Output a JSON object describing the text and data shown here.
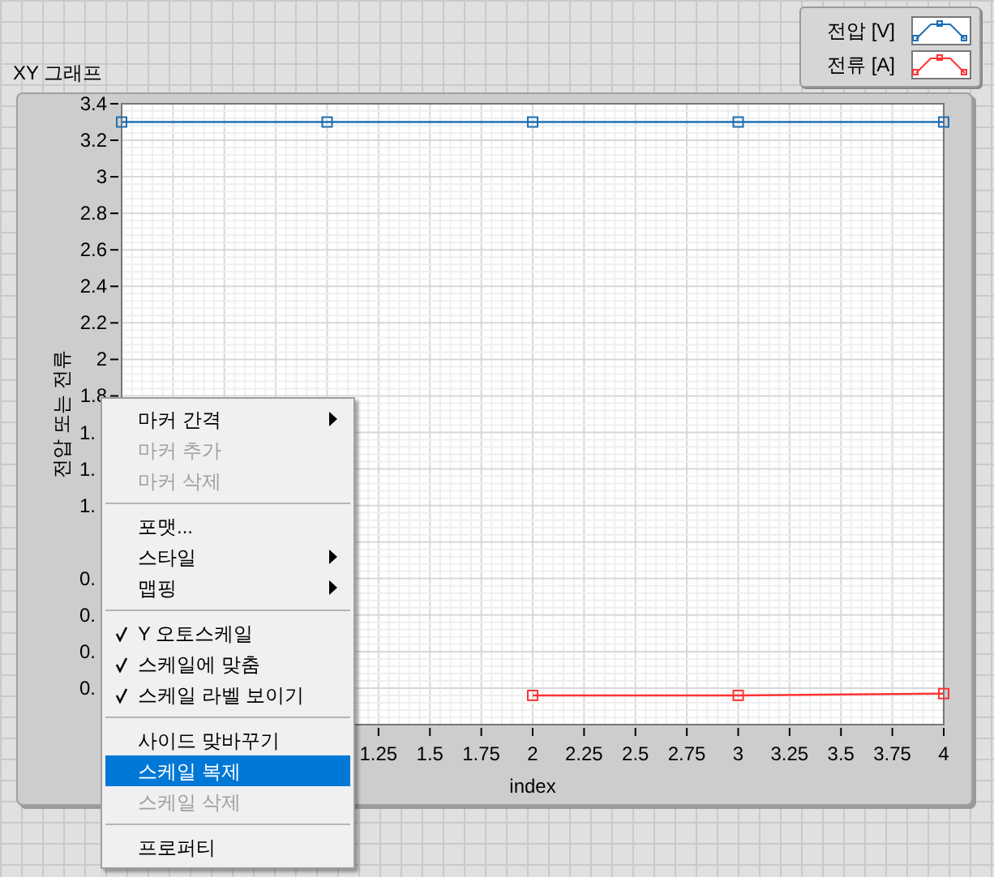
{
  "graph": {
    "title": "XY 그래프",
    "covered_y_labels": [
      "1.",
      "1.",
      "1.",
      "0.",
      "0.",
      "0.",
      "0."
    ],
    "chart_data": {
      "type": "line",
      "grid": true,
      "xlabel": "index",
      "ylabel": "전압 또는 전류",
      "xlim": [
        0,
        4
      ],
      "ylim": [
        0,
        3.4
      ],
      "xticks": [
        1.25,
        1.5,
        1.75,
        2,
        2.25,
        2.5,
        2.75,
        3,
        3.25,
        3.5,
        3.75,
        4
      ],
      "yticks": [
        1.8,
        2,
        2.2,
        2.4,
        2.6,
        2.8,
        3,
        3.2,
        3.4
      ],
      "x": [
        0,
        1,
        2,
        3,
        4
      ],
      "series": [
        {
          "name": "전압 [V]",
          "color": "#1f6fb4",
          "marker": "square",
          "values": [
            3.3,
            3.3,
            3.3,
            3.3,
            3.3
          ]
        },
        {
          "name": "전류 [A]",
          "color": "#ff3333",
          "marker": "square",
          "values": [
            null,
            null,
            0.16,
            0.16,
            0.17
          ]
        }
      ]
    }
  },
  "context_menu": [
    {
      "kind": "item",
      "label": "마커 간격",
      "submenu": true,
      "disabled": false,
      "checked": false,
      "selected": false
    },
    {
      "kind": "item",
      "label": "마커 추가",
      "submenu": false,
      "disabled": true,
      "checked": false,
      "selected": false
    },
    {
      "kind": "item",
      "label": "마커 삭제",
      "submenu": false,
      "disabled": true,
      "checked": false,
      "selected": false
    },
    {
      "kind": "separator"
    },
    {
      "kind": "item",
      "label": "포맷...",
      "submenu": false,
      "disabled": false,
      "checked": false,
      "selected": false
    },
    {
      "kind": "item",
      "label": "스타일",
      "submenu": true,
      "disabled": false,
      "checked": false,
      "selected": false
    },
    {
      "kind": "item",
      "label": "맵핑",
      "submenu": true,
      "disabled": false,
      "checked": false,
      "selected": false
    },
    {
      "kind": "separator"
    },
    {
      "kind": "item",
      "label": "Y 오토스케일",
      "submenu": false,
      "disabled": false,
      "checked": true,
      "selected": false
    },
    {
      "kind": "item",
      "label": "스케일에 맞춤",
      "submenu": false,
      "disabled": false,
      "checked": true,
      "selected": false
    },
    {
      "kind": "item",
      "label": "스케일 라벨 보이기",
      "submenu": false,
      "disabled": false,
      "checked": true,
      "selected": false
    },
    {
      "kind": "separator"
    },
    {
      "kind": "item",
      "label": "사이드 맞바꾸기",
      "submenu": false,
      "disabled": false,
      "checked": false,
      "selected": false
    },
    {
      "kind": "item",
      "label": "스케일 복제",
      "submenu": false,
      "disabled": false,
      "checked": false,
      "selected": true
    },
    {
      "kind": "item",
      "label": "스케일 삭제",
      "submenu": false,
      "disabled": true,
      "checked": false,
      "selected": false
    },
    {
      "kind": "separator"
    },
    {
      "kind": "item",
      "label": "프로퍼티",
      "submenu": false,
      "disabled": false,
      "checked": false,
      "selected": false
    }
  ]
}
